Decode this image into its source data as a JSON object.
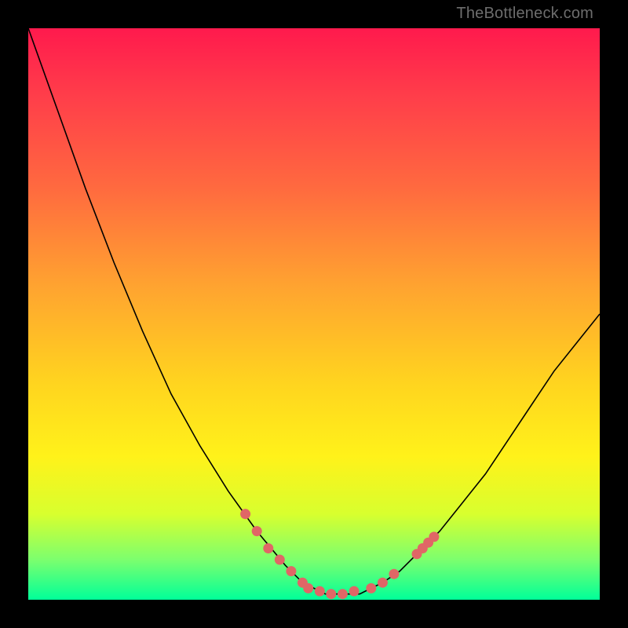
{
  "watermark": "TheBottleneck.com",
  "colors": {
    "background": "#000000",
    "curve": "#000000",
    "marker": "#e06666",
    "gradient_stops": [
      "#ff1a4d",
      "#ff3e4a",
      "#ff6a3f",
      "#ffa330",
      "#ffd41f",
      "#fff21a",
      "#d8ff2e",
      "#7cff6e",
      "#00ff99"
    ]
  },
  "chart_data": {
    "type": "line",
    "title": "",
    "xlabel": "",
    "ylabel": "",
    "xlim": [
      0,
      100
    ],
    "ylim": [
      0,
      100
    ],
    "series": [
      {
        "name": "curve",
        "x": [
          0,
          5,
          10,
          15,
          20,
          25,
          30,
          35,
          40,
          45,
          48,
          50,
          52,
          55,
          58,
          60,
          62,
          65,
          68,
          72,
          76,
          80,
          84,
          88,
          92,
          96,
          100
        ],
        "y": [
          100,
          86,
          72,
          59,
          47,
          36,
          27,
          19,
          12,
          6,
          3,
          2,
          1,
          1,
          1,
          2,
          3,
          5,
          8,
          12,
          17,
          22,
          28,
          34,
          40,
          45,
          50
        ]
      }
    ],
    "markers": [
      {
        "x": 38,
        "y": 15
      },
      {
        "x": 40,
        "y": 12
      },
      {
        "x": 42,
        "y": 9
      },
      {
        "x": 44,
        "y": 7
      },
      {
        "x": 46,
        "y": 5
      },
      {
        "x": 48,
        "y": 3
      },
      {
        "x": 49,
        "y": 2
      },
      {
        "x": 51,
        "y": 1.5
      },
      {
        "x": 53,
        "y": 1
      },
      {
        "x": 55,
        "y": 1
      },
      {
        "x": 57,
        "y": 1.5
      },
      {
        "x": 60,
        "y": 2
      },
      {
        "x": 62,
        "y": 3
      },
      {
        "x": 64,
        "y": 4.5
      },
      {
        "x": 68,
        "y": 8
      },
      {
        "x": 69,
        "y": 9
      },
      {
        "x": 70,
        "y": 10
      },
      {
        "x": 71,
        "y": 11
      }
    ]
  }
}
